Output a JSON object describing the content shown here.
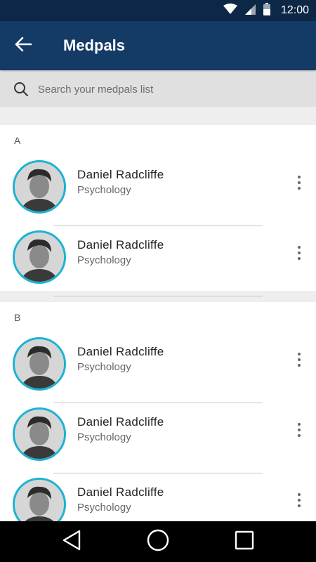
{
  "status_bar": {
    "time": "12:00",
    "icons": [
      "wifi-icon",
      "signal-icon",
      "battery-icon"
    ]
  },
  "app_bar": {
    "back_icon": "arrow-left-icon",
    "title": "Medpals"
  },
  "search": {
    "icon": "search-icon",
    "placeholder": "Search your medpals list",
    "value": ""
  },
  "sections": [
    {
      "letter": "A",
      "items": [
        {
          "name": "Daniel Radcliffe",
          "subtitle": "Psychology"
        },
        {
          "name": "Daniel Radcliffe",
          "subtitle": "Psychology"
        }
      ]
    },
    {
      "letter": "B",
      "items": [
        {
          "name": "Daniel Radcliffe",
          "subtitle": "Psychology"
        },
        {
          "name": "Daniel Radcliffe",
          "subtitle": "Psychology"
        },
        {
          "name": "Daniel Radcliffe",
          "subtitle": "Psychology"
        }
      ]
    }
  ],
  "nav_bar": {
    "icons": [
      "back-triangle-icon",
      "home-circle-icon",
      "recents-square-icon"
    ]
  },
  "colors": {
    "status_bar": "#0d2747",
    "app_bar": "#143b66",
    "avatar_ring": "#1ab3d3",
    "search_bg": "#e0e0e0"
  }
}
